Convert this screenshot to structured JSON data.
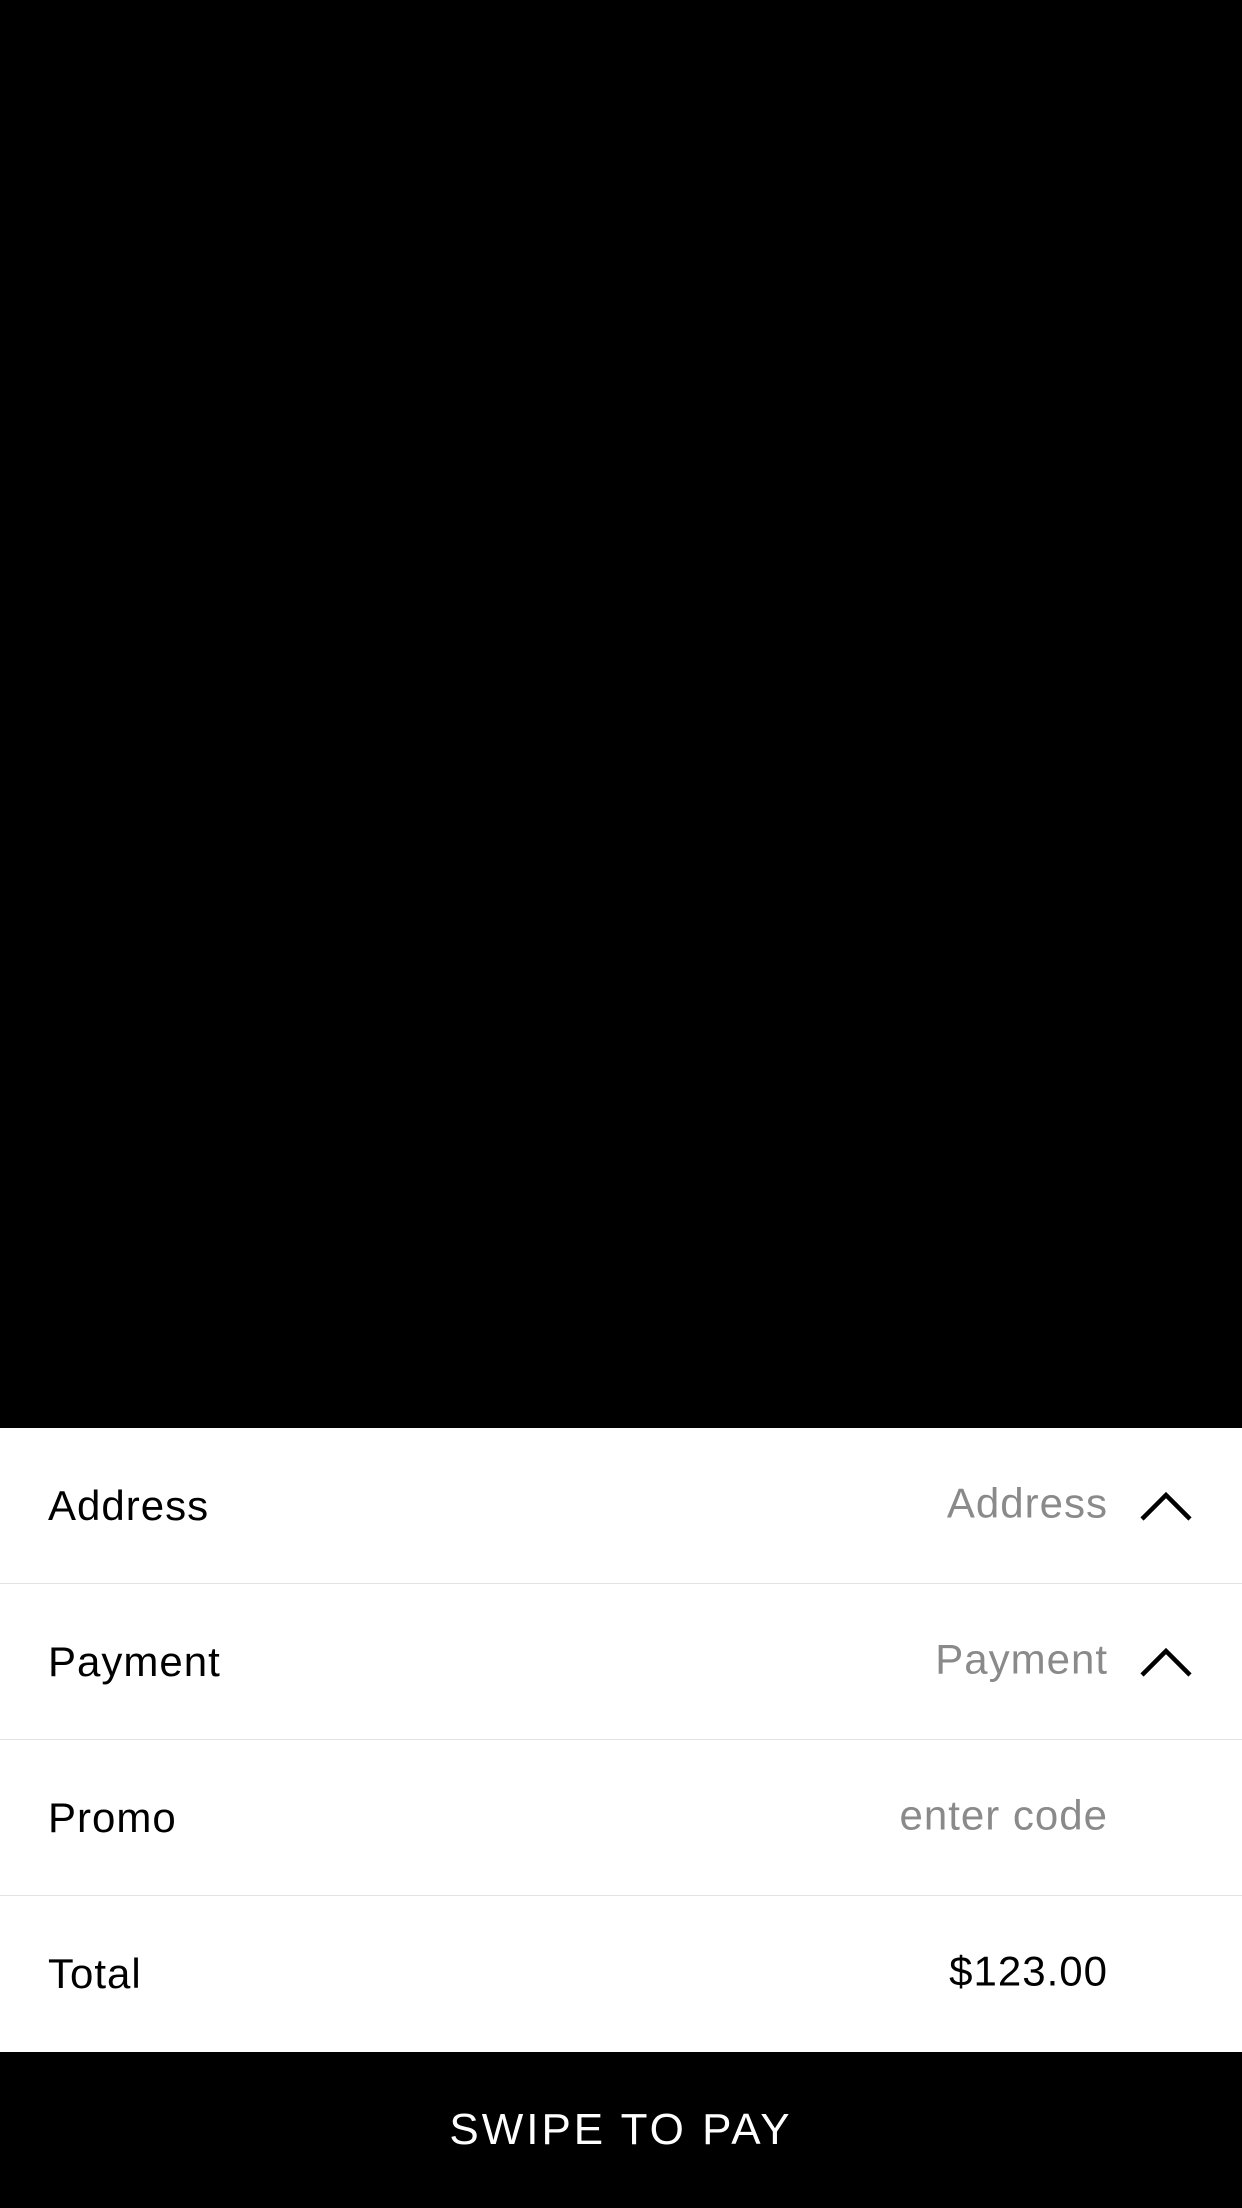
{
  "checkout": {
    "address": {
      "label": "Address",
      "value": "Address"
    },
    "payment": {
      "label": "Payment",
      "value": "Payment"
    },
    "promo": {
      "label": "Promo",
      "placeholder": "enter code"
    },
    "total": {
      "label": "Total",
      "value": "$123.00"
    }
  },
  "pay_button": {
    "label": "SWIPE TO PAY"
  },
  "icons": {
    "row_expand": "chevron-up-icon"
  },
  "colors": {
    "background": "#000000",
    "sheet": "#ffffff",
    "label_text": "#000000",
    "placeholder_text": "#8a8a8a",
    "divider": "#e3e3e3",
    "pay_text": "#ffffff"
  }
}
